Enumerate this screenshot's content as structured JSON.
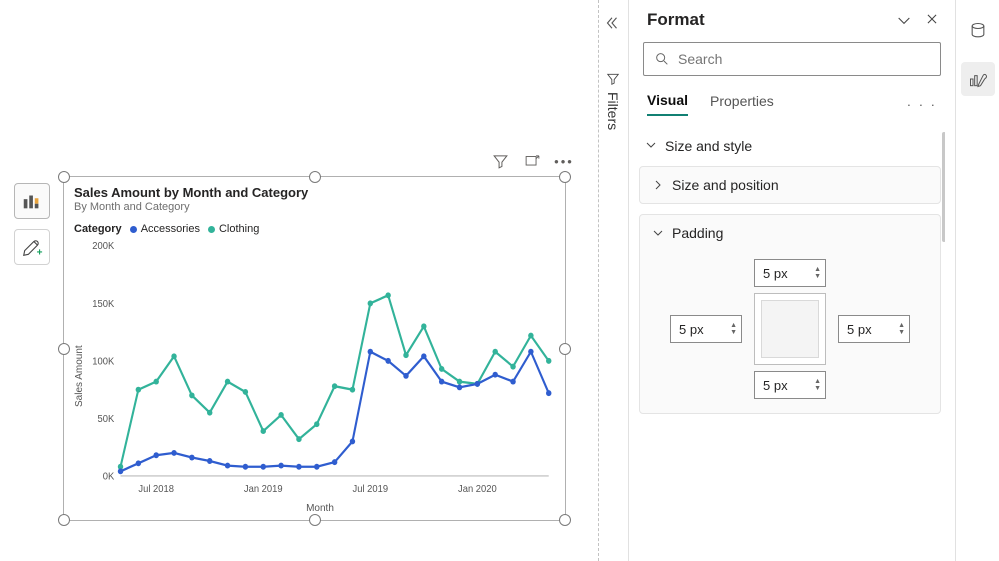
{
  "chart_data": {
    "type": "line",
    "title": "Sales Amount by Month and Category",
    "subtitle": "By Month and Category",
    "xlabel": "Month",
    "ylabel": "Sales Amount",
    "legend_title": "Category",
    "ylim": [
      0,
      200000
    ],
    "y_ticks": [
      "0K",
      "50K",
      "100K",
      "150K",
      "200K"
    ],
    "x_tick_labels": [
      "Jul 2018",
      "Jan 2019",
      "Jul 2019",
      "Jan 2020"
    ],
    "categories": [
      "May 2018",
      "Jun 2018",
      "Jul 2018",
      "Aug 2018",
      "Sep 2018",
      "Oct 2018",
      "Nov 2018",
      "Dec 2018",
      "Jan 2019",
      "Feb 2019",
      "Mar 2019",
      "Apr 2019",
      "May 2019",
      "Jun 2019",
      "Jul 2019",
      "Aug 2019",
      "Sep 2019",
      "Oct 2019",
      "Nov 2019",
      "Dec 2019",
      "Jan 2020",
      "Feb 2020",
      "Mar 2020",
      "Apr 2020",
      "May 2020"
    ],
    "series": [
      {
        "name": "Accessories",
        "color": "#2f5dcf",
        "values": [
          4000,
          11000,
          18000,
          20000,
          16000,
          13000,
          9000,
          8000,
          8000,
          9000,
          8000,
          8000,
          12000,
          30000,
          108000,
          100000,
          87000,
          104000,
          82000,
          77000,
          80000,
          88000,
          82000,
          108000,
          72000
        ]
      },
      {
        "name": "Clothing",
        "color": "#32b39a",
        "values": [
          8000,
          75000,
          82000,
          104000,
          70000,
          55000,
          82000,
          73000,
          39000,
          53000,
          32000,
          45000,
          78000,
          75000,
          150000,
          157000,
          105000,
          130000,
          93000,
          82000,
          80000,
          108000,
          95000,
          122000,
          100000
        ]
      }
    ]
  },
  "filters": {
    "label": "Filters"
  },
  "format": {
    "title": "Format",
    "search_placeholder": "Search",
    "tabs": {
      "visual": "Visual",
      "properties": "Properties"
    },
    "sections": {
      "size_style": "Size and style",
      "size_position": "Size and position",
      "padding": "Padding"
    },
    "padding_values": {
      "top": "5 px",
      "right": "5 px",
      "bottom": "5 px",
      "left": "5 px"
    }
  }
}
